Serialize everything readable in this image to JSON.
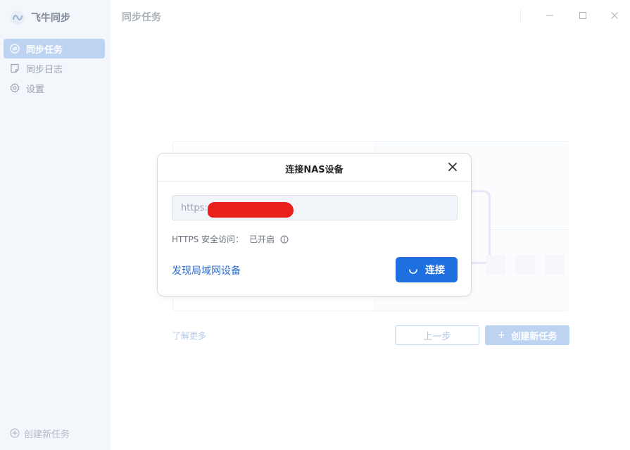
{
  "app": {
    "name": "飞牛同步",
    "accent_color": "#1e6fe0",
    "accent_light": "#bcd3f2"
  },
  "sidebar": {
    "items": [
      {
        "label": "同步任务",
        "icon": "sync-icon",
        "active": true
      },
      {
        "label": "同步日志",
        "icon": "log-icon",
        "active": false
      },
      {
        "label": "设置",
        "icon": "gear-icon",
        "active": false
      }
    ],
    "bottom_label": "创建新任务"
  },
  "header": {
    "title": "同步任务"
  },
  "background": {
    "learn_more": "了解更多",
    "prev_label": "上一步",
    "create_label": "创建新任务"
  },
  "dialog": {
    "title": "连接NAS设备",
    "url_value": "https:",
    "https_label": "HTTPS 安全访问：",
    "https_status": "已开启",
    "discover_label": "发现局域网设备",
    "connect_label": "连接"
  }
}
